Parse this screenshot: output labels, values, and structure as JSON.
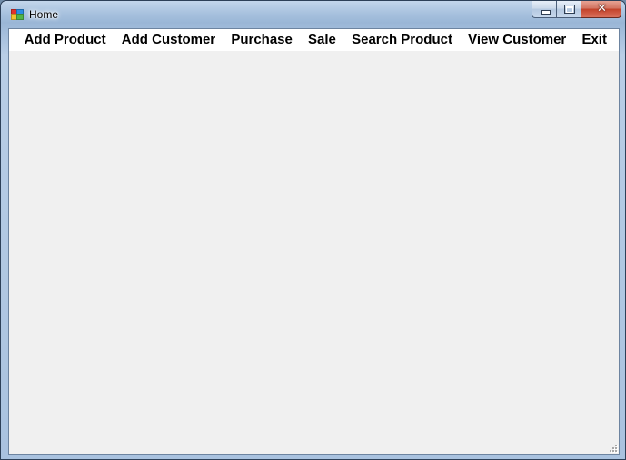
{
  "window": {
    "title": "Home"
  },
  "caption": {
    "close_glyph": "✕"
  },
  "menu": {
    "items": [
      {
        "id": "add-product",
        "label": "Add Product"
      },
      {
        "id": "add-customer",
        "label": "Add Customer"
      },
      {
        "id": "purchase",
        "label": "Purchase"
      },
      {
        "id": "sale",
        "label": "Sale"
      },
      {
        "id": "search-product",
        "label": "Search Product"
      },
      {
        "id": "view-customer",
        "label": "View Customer"
      },
      {
        "id": "exit",
        "label": "Exit"
      }
    ]
  },
  "icons": {
    "app": "windows-form-icon",
    "minimize": "minimize-icon",
    "maximize": "maximize-icon",
    "close": "close-icon",
    "grip": "size-grip-icon"
  },
  "colors": {
    "client_background": "#f0f0f0",
    "menubar_background": "#ffffff",
    "close_button": "#c3422a",
    "frame": "#a7c1de"
  }
}
